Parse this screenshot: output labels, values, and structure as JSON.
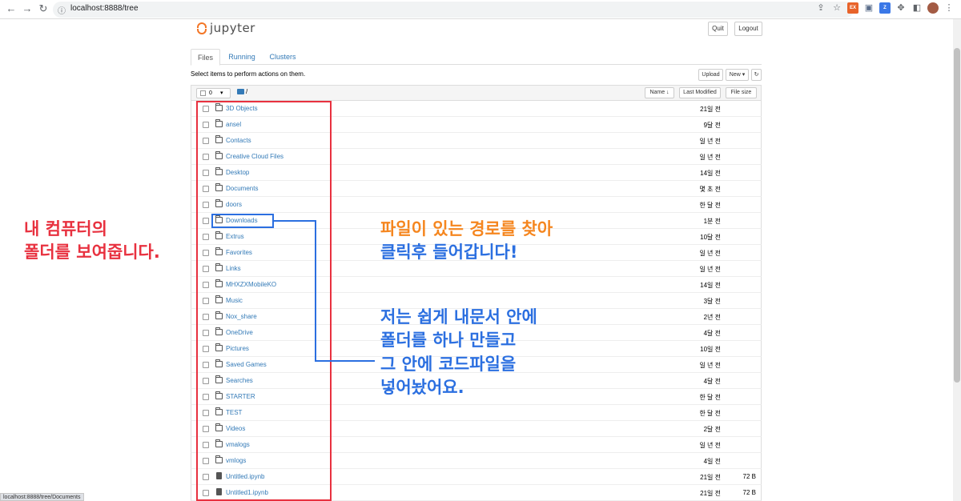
{
  "browser": {
    "url": "localhost:8888/tree",
    "status_url": "localhost:8888/tree/Documents"
  },
  "jupyter": {
    "logo_text": "jupyter",
    "quit": "Quit",
    "logout": "Logout",
    "tabs": [
      "Files",
      "Running",
      "Clusters"
    ],
    "hint": "Select items to perform actions on them.",
    "upload": "Upload",
    "new": "New ▾",
    "refresh": "↻",
    "selected_count": "0",
    "breadcrumb": "/",
    "sort_name": "Name ↓",
    "sort_modified": "Last Modified",
    "sort_size": "File size"
  },
  "files": [
    {
      "name": "3D Objects",
      "modified": "21일 전",
      "size": "",
      "type": "folder"
    },
    {
      "name": "ansel",
      "modified": "9달 전",
      "size": "",
      "type": "folder"
    },
    {
      "name": "Contacts",
      "modified": "일 년 전",
      "size": "",
      "type": "folder"
    },
    {
      "name": "Creative Cloud Files",
      "modified": "일 년 전",
      "size": "",
      "type": "folder"
    },
    {
      "name": "Desktop",
      "modified": "14일 전",
      "size": "",
      "type": "folder"
    },
    {
      "name": "Documents",
      "modified": "몇 초 전",
      "size": "",
      "type": "folder"
    },
    {
      "name": "doors",
      "modified": "한 달 전",
      "size": "",
      "type": "folder"
    },
    {
      "name": "Downloads",
      "modified": "1분 전",
      "size": "",
      "type": "folder"
    },
    {
      "name": "Extrus",
      "modified": "10달 전",
      "size": "",
      "type": "folder"
    },
    {
      "name": "Favorites",
      "modified": "일 년 전",
      "size": "",
      "type": "folder"
    },
    {
      "name": "Links",
      "modified": "일 년 전",
      "size": "",
      "type": "folder"
    },
    {
      "name": "MHXZXMobileKO",
      "modified": "14일 전",
      "size": "",
      "type": "folder"
    },
    {
      "name": "Music",
      "modified": "3달 전",
      "size": "",
      "type": "folder"
    },
    {
      "name": "Nox_share",
      "modified": "2년 전",
      "size": "",
      "type": "folder"
    },
    {
      "name": "OneDrive",
      "modified": "4달 전",
      "size": "",
      "type": "folder"
    },
    {
      "name": "Pictures",
      "modified": "10일 전",
      "size": "",
      "type": "folder"
    },
    {
      "name": "Saved Games",
      "modified": "일 년 전",
      "size": "",
      "type": "folder"
    },
    {
      "name": "Searches",
      "modified": "4달 전",
      "size": "",
      "type": "folder"
    },
    {
      "name": "STARTER",
      "modified": "한 달 전",
      "size": "",
      "type": "folder"
    },
    {
      "name": "TEST",
      "modified": "한 달 전",
      "size": "",
      "type": "folder"
    },
    {
      "name": "Videos",
      "modified": "2달 전",
      "size": "",
      "type": "folder"
    },
    {
      "name": "vmalogs",
      "modified": "일 년 전",
      "size": "",
      "type": "folder"
    },
    {
      "name": "vmlogs",
      "modified": "4일 전",
      "size": "",
      "type": "folder"
    },
    {
      "name": "Untitled.ipynb",
      "modified": "21일 전",
      "size": "72 B",
      "type": "notebook"
    },
    {
      "name": "Untitled1.ipynb",
      "modified": "21일 전",
      "size": "72 B",
      "type": "notebook"
    }
  ],
  "annotations": {
    "left_line1": "내 컴퓨터의",
    "left_line2": "폴더를 보여줍니다.",
    "right1_part1": "파일이 있는 ",
    "right1_highlight": "경로",
    "right1_part2": "를 찾아",
    "right1_line2": "클릭후 들어갑니다!",
    "right2_lines": [
      "저는 쉽게 내문서 안에",
      "폴더를 하나 만들고",
      "그 안에 코드파일을",
      "넣어놨어요."
    ]
  },
  "colors": {
    "annotation_red": "#e8313f",
    "annotation_blue": "#2b6fe0",
    "annotation_orange": "#f5861f",
    "jupyter_orange": "#f37626",
    "link_blue": "#337ab7"
  }
}
